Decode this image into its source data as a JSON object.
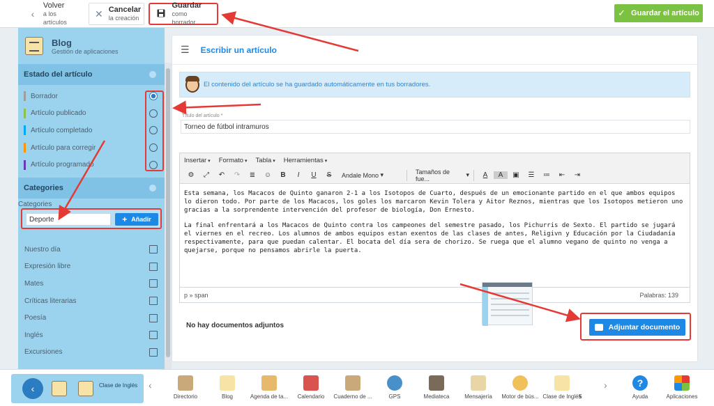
{
  "topbar": {
    "back": {
      "line1": "Volver",
      "line2": "a los artículos"
    },
    "cancel": {
      "line1": "Cancelar",
      "line2": "la creación"
    },
    "draft": {
      "line1": "Guardar",
      "line2": "como borrador"
    },
    "save": "Guardar el artículo"
  },
  "sidebar": {
    "app_title": "Blog",
    "app_subtitle": "Gestión de aplicaciones",
    "status_section": "Estado del artículo",
    "statuses": [
      {
        "label": "Borrador",
        "color": "#9e9e9e",
        "selected": true
      },
      {
        "label": "Artículo publicado",
        "color": "#8bc34a",
        "selected": false
      },
      {
        "label": "Artículo completado",
        "color": "#03a9f4",
        "selected": false
      },
      {
        "label": "Artículo para corregir",
        "color": "#ff9800",
        "selected": false
      },
      {
        "label": "Artículo programado",
        "color": "#673ab7",
        "selected": false
      }
    ],
    "categories_section": "Categories",
    "categories_label": "Categories",
    "category_input_value": "Deporte",
    "add_button": "Añadir",
    "categories": [
      "Nuestro día",
      "Expresión libre",
      "Mates",
      "Críticas literarias",
      "Poesía",
      "Inglés",
      "Excursiones"
    ]
  },
  "main": {
    "title": "Escribir un artículo",
    "notice": "El contenido del artículo se ha guardado automáticamente en tus borradores.",
    "title_label": "Título del artículo *",
    "title_value": "Torneo de fútbol intramuros",
    "menu": [
      "Insertar",
      "Formato",
      "Tabla",
      "Herramientas"
    ],
    "font_select": "Andale Mono",
    "size_select": "Tamaños de fue...",
    "paragraphs": [
      "Esta semana, los Macacos de Quinto ganaron 2-1 a los Isotopos de Cuarto, después de un emocionante partido en el que ambos equipos lo dieron todo. Por parte de los Macacos, los goles los marcaron Kevin Tolera y Aitor Reznos, mientras que los Isotopos metieron uno gracias a la sorprendente intervención del profesor de biología, Don Ernesto.",
      "La final enfrentará a los Macacos de Quinto contra los campeones del semestre pasado, los Pichurris de Sexto. El partido se jugará el viernes en el recreo. Los alumnos de ambos equipos estan exentos de las clases de antes, Religivn y Educación por la Ciudadanía respectivamente, para que puedan calentar. El bocata del día sera de chorizo. Se ruega que el alumno vegano de quinto no venga a quejarse, porque no pensamos abrirle la puerta."
    ],
    "path": "p » span",
    "word_count": "Palabras: 139",
    "no_docs": "No hay documentos adjuntos",
    "attach_button": "Adjuntar documento"
  },
  "dock": {
    "class_label": "Clase de Inglés",
    "apps": [
      "Directorio",
      "Blog",
      "Agenda de ta...",
      "Calendario",
      "Cuaderno de ...",
      "GPS",
      "Mediateca",
      "Mensajería",
      "Motor de bús...",
      "Clase de Inglés",
      "S",
      "Ayuda",
      "Aplicaciones"
    ]
  },
  "colors": {
    "accent": "#1e88e5",
    "save_green": "#7cc242",
    "highlight_red": "#e53935",
    "sidebar": "#9bd3ee"
  }
}
